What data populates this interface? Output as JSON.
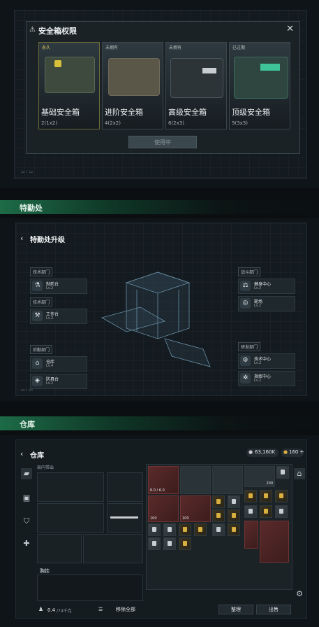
{
  "panel1": {
    "dialog_title": "安全箱权限",
    "close": "✕",
    "cards": [
      {
        "tag": "永久",
        "name": "基础安全箱",
        "size": "2(1x2)"
      },
      {
        "tag": "未拥有",
        "name": "进阶安全箱",
        "size": "4(2x2)"
      },
      {
        "tag": "未拥有",
        "name": "高级安全箱",
        "size": "6(2x3)"
      },
      {
        "tag": "已过期",
        "name": "顶级安全箱",
        "size": "9(3x3)"
      }
    ],
    "using_button": "使用中"
  },
  "section2": {
    "label": "特勤处",
    "title": "特勤处升级",
    "depts": [
      {
        "header": "技术部门",
        "name": "制药台",
        "level": "Lv.2"
      },
      {
        "header": "技术部门",
        "name": "工作台",
        "level": "Lv.2"
      },
      {
        "header": "后勤部门",
        "name": "仓库",
        "level": "Lv.4"
      },
      {
        "header": "后勤部门",
        "name": "防具台",
        "level": "Lv.2"
      },
      {
        "header": "战斗部门",
        "name": "健身中心",
        "level": "Lv.3"
      },
      {
        "header": "战斗部门",
        "name": "靶场",
        "level": "Lv.2"
      },
      {
        "header": "研发部门",
        "name": "技术中心",
        "level": "Lv.2"
      },
      {
        "header": "研发部门",
        "name": "指挥中心",
        "level": "Lv.2"
      }
    ]
  },
  "section3": {
    "label": "仓库",
    "title": "仓库",
    "currency1": "63,160K",
    "currency2": "160",
    "loadout_label": "局内带出",
    "weight": "0.4",
    "weight_max": "/74千克",
    "remove_all": "移除全部",
    "backpack_label": "胸挂",
    "sort_button": "整理",
    "sell_button": "出售",
    "durability1": "6.0 / 6.0",
    "item_count1": "100",
    "item_count2": "200",
    "item_count3": "100"
  },
  "colors": {
    "accent_green": "#1d6b47",
    "gold_item": "#d9b040",
    "red_item": "#5a2a2a"
  }
}
